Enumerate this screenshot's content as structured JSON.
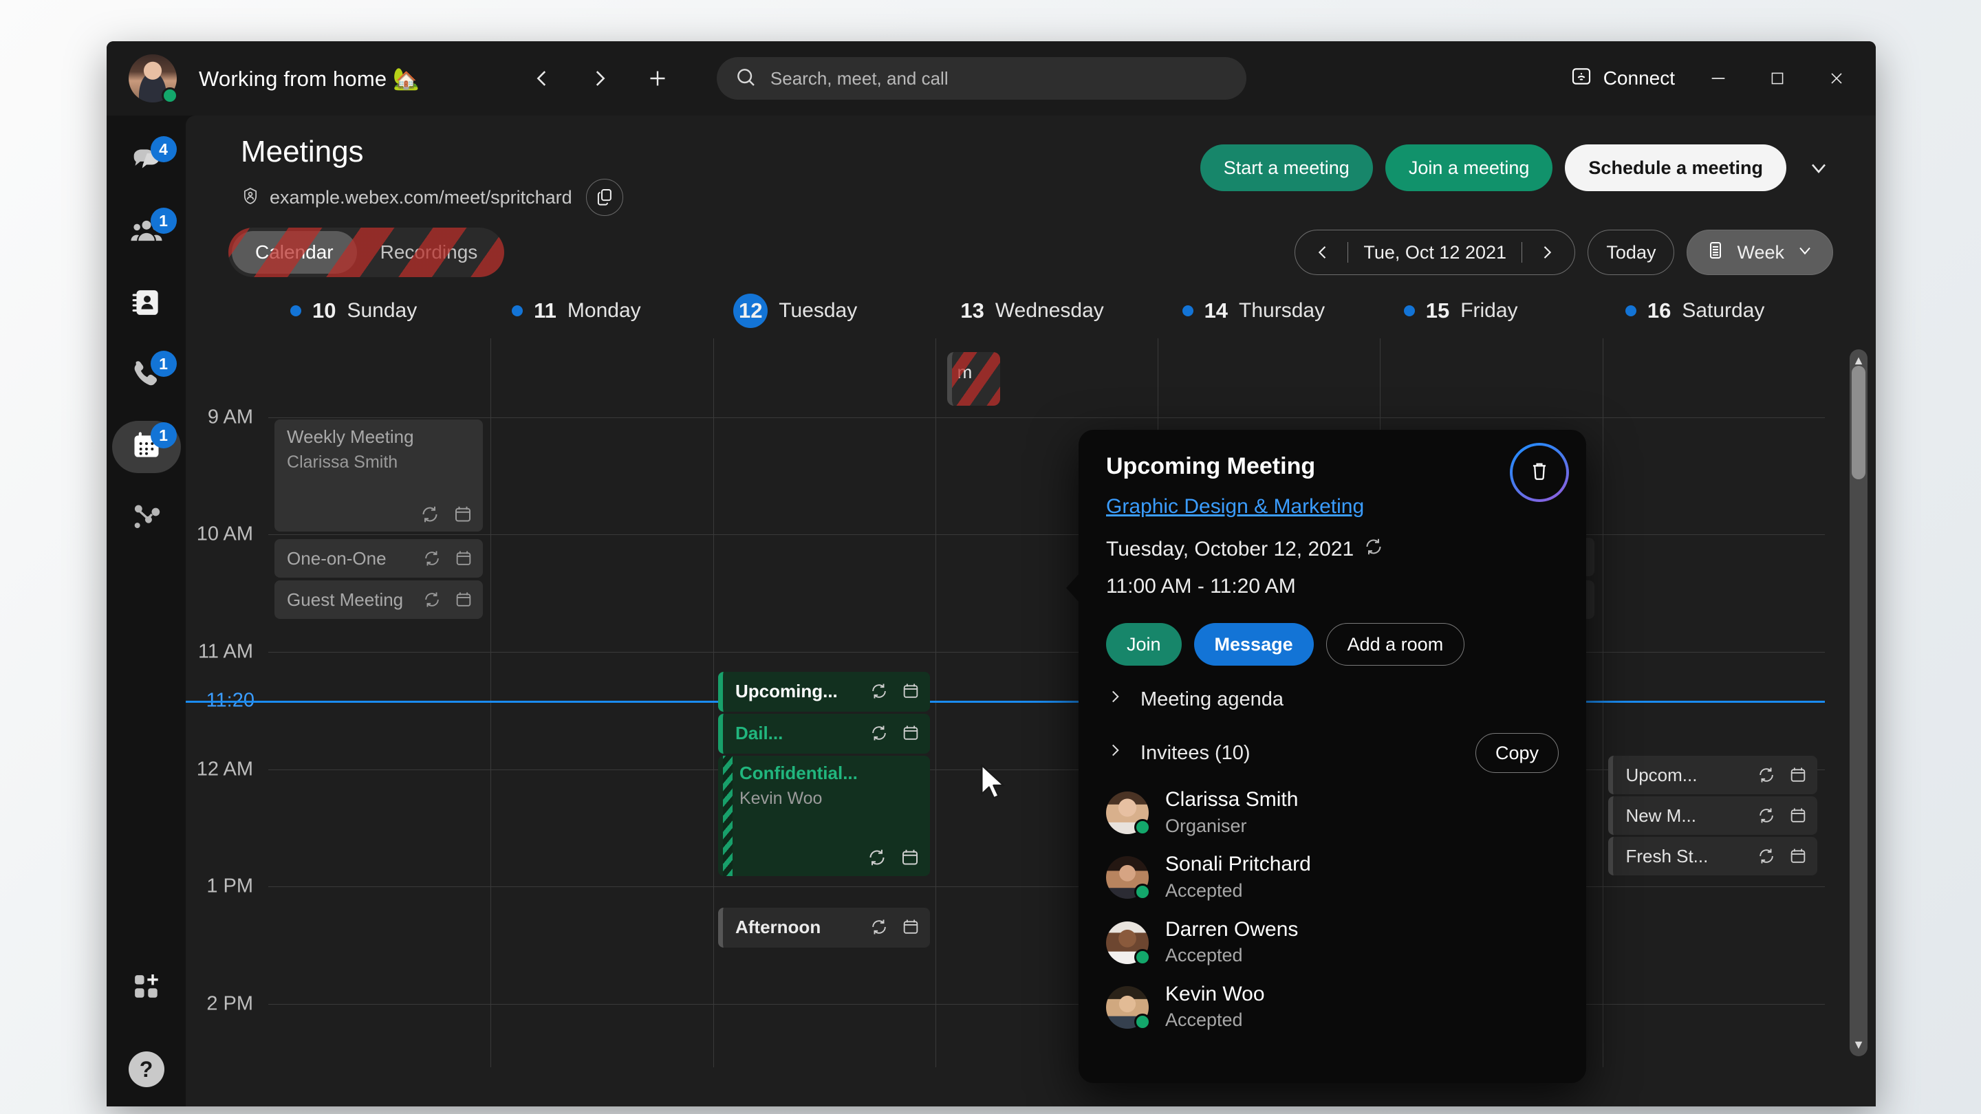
{
  "titlebar": {
    "status_text": "Working from home 🏡",
    "back_icon": "chevron-left-icon",
    "forward_icon": "chevron-right-icon",
    "add_icon": "plus-icon",
    "search_placeholder": "Search, meet, and call",
    "search_value": "",
    "connect_label": "Connect",
    "minimize_label": "—",
    "maximize_label": "□",
    "close_label": "✕"
  },
  "rail": {
    "items": [
      {
        "name": "messaging",
        "icon": "chat-bubbles-icon",
        "badge": "4",
        "active": false
      },
      {
        "name": "teams",
        "icon": "people-icon",
        "badge": "1",
        "active": false
      },
      {
        "name": "contacts",
        "icon": "contact-card-icon",
        "badge": "",
        "active": false
      },
      {
        "name": "calling",
        "icon": "phone-icon",
        "badge": "1",
        "active": false
      },
      {
        "name": "meetings",
        "icon": "calendar-icon",
        "badge": "1",
        "active": true
      },
      {
        "name": "insights",
        "icon": "share-nodes-icon",
        "badge": "",
        "active": false
      }
    ],
    "apps_icon": "apps-add-icon",
    "help_icon": "help-icon",
    "help_label": "?"
  },
  "header": {
    "title": "Meetings",
    "site_icon": "personal-room-icon",
    "site_url": "example.webex.com/meet/spritchard",
    "copy_icon": "copy-icon",
    "start_label": "Start a meeting",
    "join_label": "Join a meeting",
    "schedule_label": "Schedule a meeting",
    "chevron_icon": "chevron-down-icon"
  },
  "toolbar": {
    "tabs": [
      {
        "label": "Calendar",
        "active": true
      },
      {
        "label": "Recordings",
        "active": false
      }
    ],
    "prev_icon": "chevron-left-icon",
    "next_icon": "chevron-right-icon",
    "date_label": "Tue, Oct 12 2021",
    "today_label": "Today",
    "view_icon": "calendar-view-icon",
    "view_label": "Week",
    "view_chevron": "chevron-down-icon"
  },
  "days": [
    {
      "num": "10",
      "name": "Sunday",
      "dot": true,
      "today": false
    },
    {
      "num": "11",
      "name": "Monday",
      "dot": true,
      "today": false
    },
    {
      "num": "12",
      "name": "Tuesday",
      "dot": false,
      "today": true
    },
    {
      "num": "13",
      "name": "Wednesday",
      "dot": false,
      "today": false
    },
    {
      "num": "14",
      "name": "Thursday",
      "dot": true,
      "today": false
    },
    {
      "num": "15",
      "name": "Friday",
      "dot": true,
      "today": false
    },
    {
      "num": "16",
      "name": "Saturday",
      "dot": true,
      "today": false
    }
  ],
  "grid": {
    "hours": [
      "9 AM",
      "10 AM",
      "11 AM",
      "12 AM",
      "1 PM",
      "2 PM"
    ],
    "now_label": "11:20",
    "recurring_icon": "recurring-icon",
    "calendar_icon": "calendar-chip-icon"
  },
  "events": [
    {
      "title": "Weekly Meeting",
      "subtitle": "Clarissa Smith"
    },
    {
      "title": "One-on-One",
      "subtitle": ""
    },
    {
      "title": "Guest Meeting",
      "subtitle": ""
    },
    {
      "title": "m",
      "subtitle": ""
    },
    {
      "title": "Upcoming...",
      "subtitle": ""
    },
    {
      "title": "Dail...",
      "subtitle": ""
    },
    {
      "title": "Confidential...",
      "subtitle": "Kevin Woo"
    },
    {
      "title": "Afternoon",
      "subtitle": ""
    },
    {
      "title": "Upcom...",
      "subtitle": ""
    },
    {
      "title": "New M...",
      "subtitle": ""
    },
    {
      "title": "Fresh St...",
      "subtitle": ""
    }
  ],
  "popup": {
    "title": "Upcoming Meeting",
    "space_link": "Graphic Design & Marketing",
    "date": "Tuesday, October 12, 2021",
    "recurring_icon": "recurring-icon",
    "time": "11:00 AM - 11:20 AM",
    "join_label": "Join",
    "message_label": "Message",
    "add_room_label": "Add a room",
    "agenda_label": "Meeting agenda",
    "invitees_label": "Invitees (10)",
    "copy_label": "Copy",
    "delete_icon": "trash-icon",
    "expand_icon": "chevron-right-icon",
    "invitees": [
      {
        "name": "Clarissa Smith",
        "role": "Organiser"
      },
      {
        "name": "Sonali Pritchard",
        "role": "Accepted"
      },
      {
        "name": "Darren Owens",
        "role": "Accepted"
      },
      {
        "name": "Kevin Woo",
        "role": "Accepted"
      }
    ]
  },
  "colors": {
    "accent_blue": "#1374d6",
    "green": "#17866a",
    "now_line": "#1a8bf0",
    "event_green": "#18a06a",
    "highlight_red": "#ba2d28"
  }
}
